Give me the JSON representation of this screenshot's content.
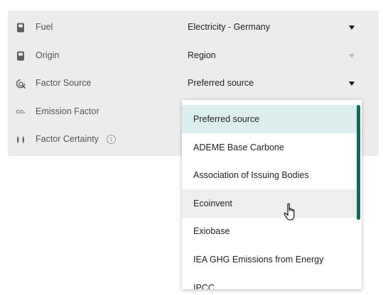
{
  "fields": [
    {
      "label": "Fuel",
      "value": "Electricity - Germany",
      "icon": "fuel-icon",
      "caret": "enabled"
    },
    {
      "label": "Origin",
      "value": "Region",
      "icon": "origin-icon",
      "caret": "disabled"
    },
    {
      "label": "Factor Source",
      "value": "Preferred source",
      "icon": "factor-source-icon",
      "caret": "enabled"
    },
    {
      "label": "Emission Factor",
      "value": "",
      "icon": "co2-icon",
      "icon_text": "CO₂"
    },
    {
      "label": "Factor Certainty",
      "value": "",
      "icon": "certainty-icon",
      "info_icon": "i"
    }
  ],
  "dropdown": {
    "options": [
      "Preferred source",
      "ADEME Base Carbone",
      "Association of Issuing Bodies",
      "Ecoinvent",
      "Exiobase",
      "IEA GHG Emissions from Energy",
      "IPCC"
    ],
    "selected": "Preferred source",
    "hovered": "Ecoinvent"
  },
  "colors": {
    "panel_background": "#ececec",
    "selected_option": "#dceeed",
    "hover_option": "#eeeeee",
    "scrollbar": "#0e6b5b"
  }
}
